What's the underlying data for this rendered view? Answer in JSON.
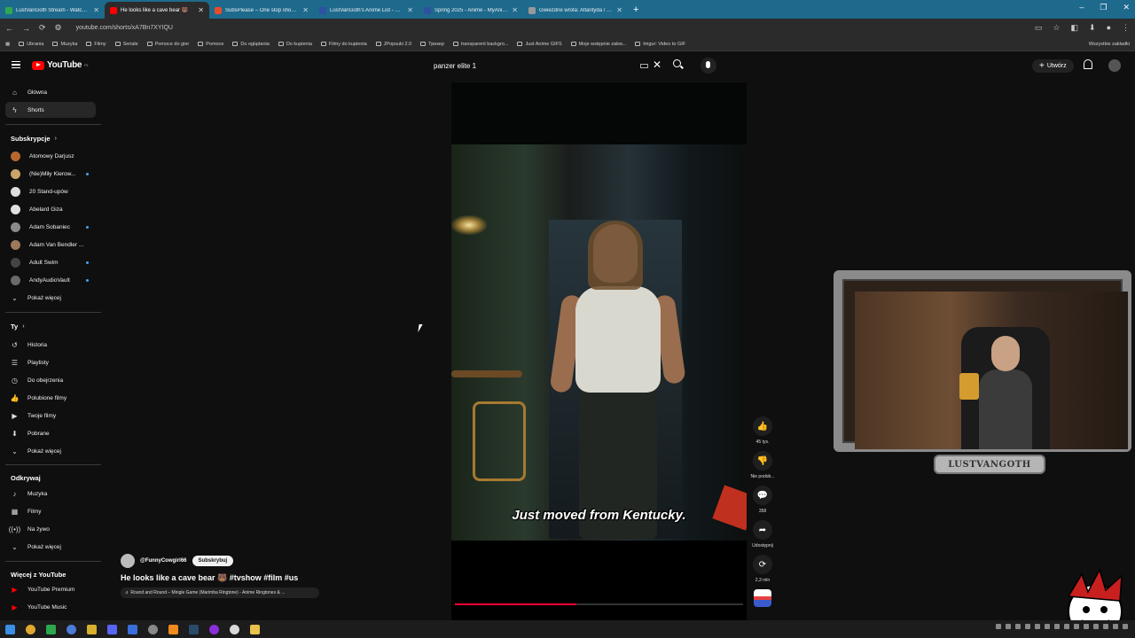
{
  "browser": {
    "tabs": [
      {
        "title": "LustVanGoth Stream - Watch Li...",
        "color": "#2fa84f",
        "active": false
      },
      {
        "title": "He looks like a cave bear 🐻",
        "color": "#ff0000",
        "active": true
      },
      {
        "title": "SubsPlease – One stop shop fo...",
        "color": "#e84b2c",
        "active": false
      },
      {
        "title": "LustVanGoth's Anime List - My...",
        "color": "#2e51a2",
        "active": false
      },
      {
        "title": "Spring 2025 - Anime - MyAnim...",
        "color": "#2e51a2",
        "active": false
      },
      {
        "title": "Gwiezdne wrota: Atlantyda / S...",
        "color": "#999999",
        "active": false
      }
    ],
    "url": "youtube.com/shorts/xA7Bn7XYIQU",
    "bookmarks": [
      "Ubrania",
      "Muzyka",
      "Filmy",
      "Seriale",
      "Pomoce do gier",
      "Pomoce",
      "Do oglądania",
      "Do kupienia",
      "Filmy do kupienia",
      "JPopsuki 2.0",
      "Трекер",
      "transparent backgro...",
      "Just Anime GIFS",
      "Moje wstępnie zakw...",
      "Imgur: Video to GIF"
    ],
    "bookmarks_right": "Wszystkie zakładki"
  },
  "youtube": {
    "logo_text": "YouTube",
    "logo_region": "PL",
    "search_query": "panzer elite 1",
    "create_label": "Utwórz",
    "nav": [
      {
        "label": "Główna",
        "icon": "home-icon"
      },
      {
        "label": "Shorts",
        "icon": "shorts-icon",
        "active": true
      }
    ],
    "subs_heading": "Subskrypcje",
    "subscriptions": [
      {
        "name": "Atomowy Darjusz",
        "color": "#b5672f",
        "dot": false
      },
      {
        "name": "(Nie)Miły Kierow...",
        "color": "#c9a56a",
        "dot": true
      },
      {
        "name": "20 Stand-upów",
        "color": "#dddddd",
        "dot": false
      },
      {
        "name": "Abelard Giza",
        "color": "#e0e0e0",
        "dot": false
      },
      {
        "name": "Adam Sobaniec",
        "color": "#8a8a8a",
        "dot": true
      },
      {
        "name": "Adam Van Bendler ...",
        "color": "#9a7a5a",
        "dot": false
      },
      {
        "name": "Adult Swim",
        "color": "#444444",
        "dot": true
      },
      {
        "name": "AndyAudioVault",
        "color": "#6a6a6a",
        "dot": true
      }
    ],
    "show_more": "Pokaż więcej",
    "you_heading": "Ty",
    "you_items": [
      {
        "label": "Historia",
        "icon": "history-icon"
      },
      {
        "label": "Playlisty",
        "icon": "playlist-icon"
      },
      {
        "label": "Do obejrzenia",
        "icon": "watch-later-icon"
      },
      {
        "label": "Polubione filmy",
        "icon": "like-icon"
      },
      {
        "label": "Twoje filmy",
        "icon": "your-videos-icon"
      },
      {
        "label": "Pobrane",
        "icon": "download-icon"
      }
    ],
    "explore_heading": "Odkrywaj",
    "explore_items": [
      {
        "label": "Muzyka",
        "icon": "music-icon"
      },
      {
        "label": "Filmy",
        "icon": "film-icon"
      },
      {
        "label": "Na żywo",
        "icon": "live-icon"
      }
    ],
    "more_heading": "Więcej z YouTube",
    "more_items": [
      {
        "label": "YouTube Premium",
        "color": "#ff0000"
      },
      {
        "label": "YouTube Music",
        "color": "#ff0000"
      }
    ]
  },
  "short": {
    "caption": "Just moved from Kentucky.",
    "channel": "@FunnyCowgirl66",
    "subscribe_label": "Subskrybuj",
    "title": "He looks like a cave bear 🐻 #tvshow #film #us",
    "music": "♬ Round and Round – Mingle Game (Marimba Ringtone) - Anime Ringtones & ...",
    "progress_fraction": 0.42,
    "actions": [
      {
        "name": "like",
        "icon": "👍",
        "label": "45 tys."
      },
      {
        "name": "dislike",
        "icon": "👎",
        "label": "Nie podob..."
      },
      {
        "name": "comments",
        "icon": "💬",
        "label": "358"
      },
      {
        "name": "share",
        "icon": "➦",
        "label": "Udostępnij"
      },
      {
        "name": "remix",
        "icon": "⟳",
        "label": "2,3 mln"
      }
    ]
  },
  "stream_overlay": {
    "name_plate": "LUSTVANGOTH"
  }
}
